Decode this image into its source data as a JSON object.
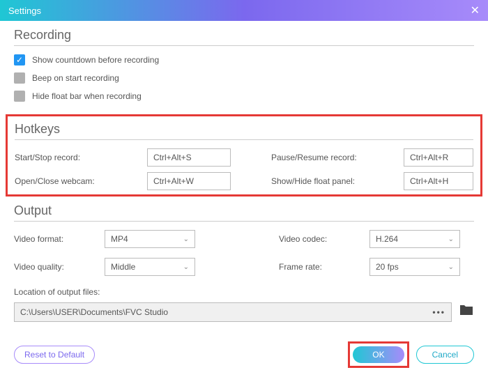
{
  "window": {
    "title": "Settings"
  },
  "recording": {
    "title": "Recording",
    "opts": [
      {
        "label": "Show countdown before recording",
        "checked": true
      },
      {
        "label": "Beep on start recording",
        "checked": false
      },
      {
        "label": "Hide float bar when recording",
        "checked": false
      }
    ]
  },
  "hotkeys": {
    "title": "Hotkeys",
    "rows": [
      {
        "l1": "Start/Stop record:",
        "v1": "Ctrl+Alt+S",
        "l2": "Pause/Resume record:",
        "v2": "Ctrl+Alt+R"
      },
      {
        "l1": "Open/Close webcam:",
        "v1": "Ctrl+Alt+W",
        "l2": "Show/Hide float panel:",
        "v2": "Ctrl+Alt+H"
      }
    ]
  },
  "output": {
    "title": "Output",
    "video_format_label": "Video format:",
    "video_format": "MP4",
    "video_codec_label": "Video codec:",
    "video_codec": "H.264",
    "video_quality_label": "Video quality:",
    "video_quality": "Middle",
    "frame_rate_label": "Frame rate:",
    "frame_rate": "20 fps",
    "location_label": "Location of output files:",
    "location_path": "C:\\Users\\USER\\Documents\\FVC Studio"
  },
  "buttons": {
    "reset": "Reset to Default",
    "ok": "OK",
    "cancel": "Cancel"
  }
}
